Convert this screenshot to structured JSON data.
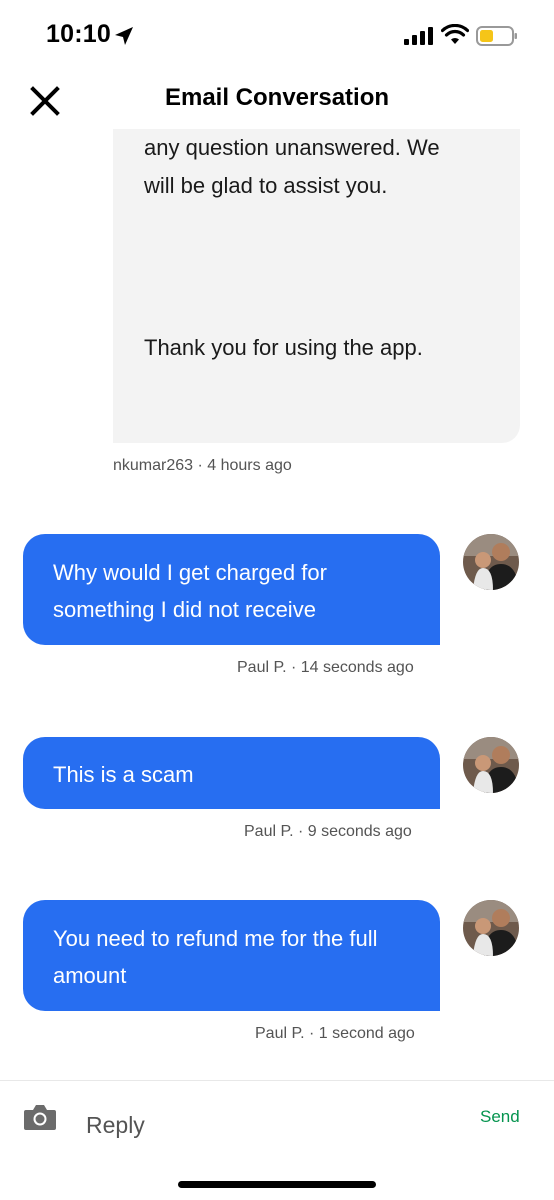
{
  "status_bar": {
    "time": "10:10",
    "icons": [
      "location-arrow-icon",
      "cellular-signal-icon",
      "wifi-icon",
      "battery-low-icon"
    ],
    "battery_color": "#f5c518"
  },
  "header": {
    "title": "Email Conversation",
    "close_icon": "close-icon"
  },
  "colors": {
    "outgoing_bubble": "#276ef1",
    "incoming_bubble": "#f3f3f3",
    "send_text": "#05944f",
    "meta_text": "#545454"
  },
  "messages": [
    {
      "direction": "incoming",
      "lines": [
        "any question unanswered. We",
        "will be glad to assist you.",
        "Thank you for using the app."
      ],
      "meta": "nkumar263 · 4 hours ago"
    },
    {
      "direction": "outgoing",
      "lines": [
        "Why would I get charged for",
        "something I did not receive"
      ],
      "meta": "Paul P. · 14 seconds ago"
    },
    {
      "direction": "outgoing",
      "lines": [
        "This is a scam"
      ],
      "meta": "Paul P. · 9 seconds ago"
    },
    {
      "direction": "outgoing",
      "lines": [
        "You need to refund me for the full",
        "amount"
      ],
      "meta": "Paul P. · 1 second ago"
    }
  ],
  "composer": {
    "placeholder": "Reply",
    "send_label": "Send",
    "camera_icon": "camera-icon"
  }
}
